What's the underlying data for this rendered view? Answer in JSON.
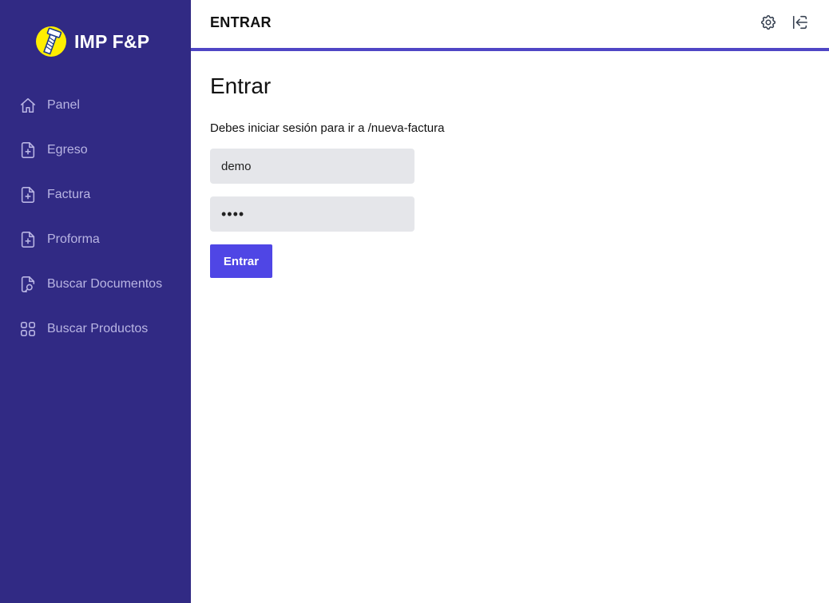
{
  "brand": {
    "name": "IMP F&P",
    "logo_icon": "bolt-logo-icon",
    "logo_color": "#ffee00"
  },
  "sidebar": {
    "background": "#312a84",
    "items": [
      {
        "label": "Panel",
        "icon": "home-icon"
      },
      {
        "label": "Egreso",
        "icon": "document-plus-icon"
      },
      {
        "label": "Factura",
        "icon": "document-plus-icon"
      },
      {
        "label": "Proforma",
        "icon": "document-plus-icon"
      },
      {
        "label": "Buscar Documentos",
        "icon": "document-search-icon"
      },
      {
        "label": "Buscar Productos",
        "icon": "grid-icon"
      }
    ]
  },
  "header": {
    "title": "ENTRAR",
    "accent_color": "#4f46c5",
    "actions": [
      {
        "icon": "gear-icon"
      },
      {
        "icon": "logout-icon"
      }
    ]
  },
  "login": {
    "title": "Entrar",
    "message": "Debes iniciar sesión para ir a /nueva-factura",
    "username_value": "demo",
    "password_value": "demo",
    "submit_label": "Entrar",
    "submit_color": "#4f46e5"
  }
}
